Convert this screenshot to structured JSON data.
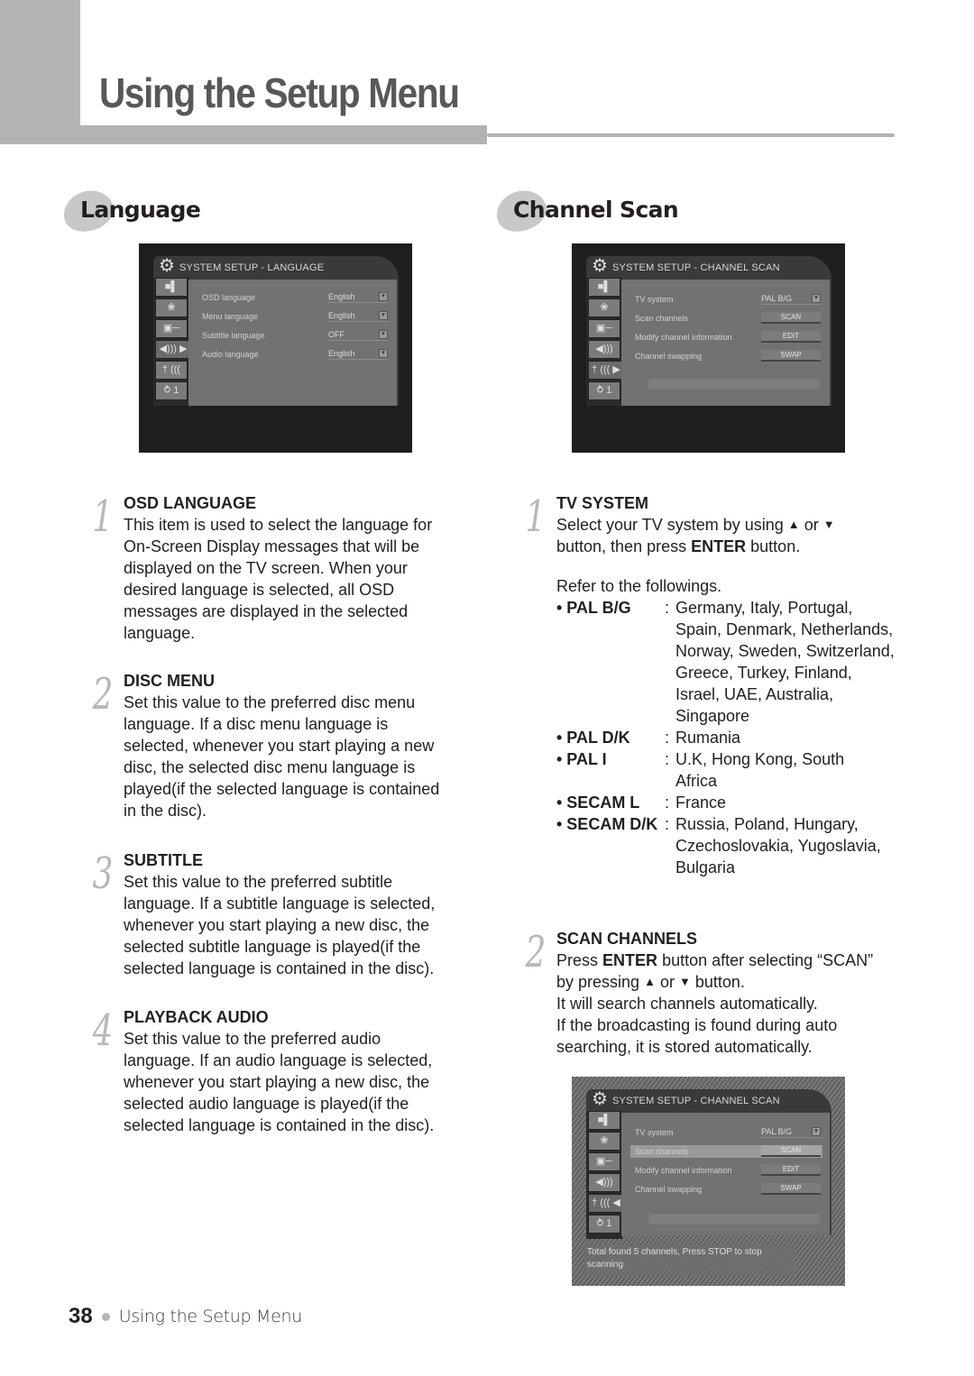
{
  "header": {
    "title": "Using the Setup Menu"
  },
  "sections": {
    "language": {
      "title": "Language"
    },
    "channel_scan": {
      "title": "Channel Scan"
    }
  },
  "osd_language": {
    "title": "SYSTEM SETUP - LANGUAGE",
    "gear_icon": "⚙",
    "tabs": [
      "■▌",
      "❀",
      "▣─",
      "◀))) ▶",
      "† (((",
      "⥁ 1"
    ],
    "rows": [
      {
        "label": "OSD language",
        "value": "English",
        "dropdown_icon": "▾"
      },
      {
        "label": "Menu language",
        "value": "English",
        "dropdown_icon": "▾"
      },
      {
        "label": "Subtitle language",
        "value": "OFF",
        "dropdown_icon": "▾"
      },
      {
        "label": "Audio language",
        "value": "English",
        "dropdown_icon": "▾"
      }
    ]
  },
  "osd_channel_scan": {
    "title": "SYSTEM SETUP - CHANNEL SCAN",
    "gear_icon": "⚙",
    "tabs": [
      "■▌",
      "❀",
      "▣─",
      "◀)))",
      "† ((( ▶",
      "⥁ 1"
    ],
    "tv_system": {
      "label": "TV system",
      "value": "PAL B/G",
      "dropdown_icon": "▾"
    },
    "buttons": [
      {
        "label": "Scan channels",
        "button": "SCAN"
      },
      {
        "label": "Modify channel information",
        "button": "EDIT"
      },
      {
        "label": "Channel swapping",
        "button": "SWAP"
      }
    ]
  },
  "osd_scanning": {
    "title": "SYSTEM SETUP - CHANNEL SCAN",
    "gear_icon": "⚙",
    "tabs": [
      "■▌",
      "❀",
      "▣─",
      "◀)))",
      "† ((( ◀",
      "⥁ 1"
    ],
    "tv_system": {
      "label": "TV system",
      "value": "PAL B/G",
      "dropdown_icon": "▾"
    },
    "buttons": [
      {
        "label": "Scan channels",
        "button": "SCAN"
      },
      {
        "label": "Modify channel information",
        "button": "EDIT"
      },
      {
        "label": "Channel swapping",
        "button": "SWAP"
      }
    ],
    "status": "Total found 5 channels, Press STOP to stop scanning"
  },
  "language_steps": [
    {
      "num": "1",
      "head": "OSD LANGUAGE",
      "body": "This item is used to select the language for On-Screen Display messages that will be displayed on the TV screen. When your desired language is selected, all OSD messages are displayed in the selected language."
    },
    {
      "num": "2",
      "head": "DISC MENU",
      "body": "Set this value to the preferred disc menu language. If a disc menu language is selected, whenever you start playing a new disc, the selected disc menu language is played(if the selected language is contained in the disc)."
    },
    {
      "num": "3",
      "head": "SUBTITLE",
      "body": "Set this value to the preferred subtitle language. If a subtitle language is selected, whenever you start playing a new disc, the selected subtitle language is played(if the selected language is contained in the disc)."
    },
    {
      "num": "4",
      "head": "PLAYBACK AUDIO",
      "body": "Set this value to the preferred audio language. If an audio language is selected, whenever you start playing a new disc, the selected audio language is played(if the selected language is contained in the disc)."
    }
  ],
  "channel_steps": {
    "tv_system": {
      "num": "1",
      "head": "TV SYSTEM",
      "line1_a": "Select your TV system by using",
      "up_icon": "▲",
      "or": "or",
      "down_icon": "▼",
      "line2_a": "button, then press",
      "enter": "ENTER",
      "line2_b": "button.",
      "refer": "Refer to the followings.",
      "systems": [
        {
          "name": "• PAL B/G",
          "countries": "Germany, Italy, Portugal, Spain, Denmark, Netherlands, Norway, Sweden, Switzerland, Greece, Turkey, Finland, Israel, UAE, Australia, Singapore"
        },
        {
          "name": "• PAL D/K",
          "countries": "Rumania"
        },
        {
          "name": "• PAL I",
          "countries": "U.K, Hong Kong, South Africa"
        },
        {
          "name": "• SECAM L",
          "countries": "France"
        },
        {
          "name": "• SECAM D/K",
          "countries": "Russia, Poland, Hungary, Czechoslovakia, Yugoslavia, Bulgaria"
        }
      ]
    },
    "scan_channels": {
      "num": "2",
      "head": "SCAN CHANNELS",
      "press": "Press",
      "enter": "ENTER",
      "after": "button after selecting “SCAN”",
      "by_pressing": "by pressing",
      "up_icon": "▲",
      "or": "or",
      "down_icon": "▼",
      "button_word": "button.",
      "line3": "It will search channels automatically.",
      "line4": "If the broadcasting is found during auto searching, it is stored automatically."
    }
  },
  "footer": {
    "page_number": "38",
    "label": "Using the Setup Menu"
  }
}
